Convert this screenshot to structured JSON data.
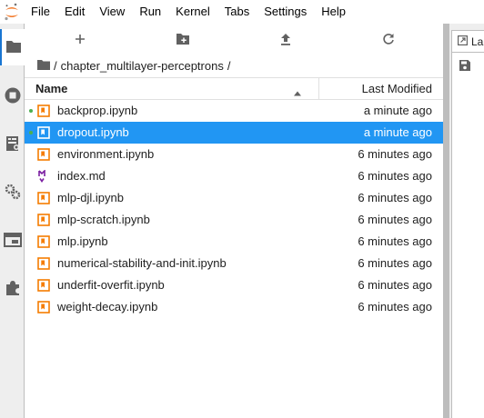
{
  "menubar": {
    "items": [
      "File",
      "Edit",
      "View",
      "Run",
      "Kernel",
      "Tabs",
      "Settings",
      "Help"
    ]
  },
  "activity_bar": {
    "icons": [
      "folder-icon",
      "running-icon",
      "commands-icon",
      "property-inspector-icon",
      "tabs-icon",
      "extension-icon"
    ]
  },
  "file_browser": {
    "toolbar": [
      "new-launcher-icon",
      "new-folder-icon",
      "upload-icon",
      "refresh-icon"
    ],
    "breadcrumb": {
      "separator": "/",
      "folder": "chapter_multilayer-perceptrons"
    },
    "header": {
      "name": "Name",
      "last_modified": "Last Modified"
    },
    "files": [
      {
        "name": "backprop.ipynb",
        "modified": "a minute ago",
        "type": "notebook",
        "running": true,
        "selected": false
      },
      {
        "name": "dropout.ipynb",
        "modified": "a minute ago",
        "type": "notebook",
        "running": true,
        "selected": true
      },
      {
        "name": "environment.ipynb",
        "modified": "6 minutes ago",
        "type": "notebook",
        "running": false,
        "selected": false
      },
      {
        "name": "index.md",
        "modified": "6 minutes ago",
        "type": "markdown",
        "running": false,
        "selected": false
      },
      {
        "name": "mlp-djl.ipynb",
        "modified": "6 minutes ago",
        "type": "notebook",
        "running": false,
        "selected": false
      },
      {
        "name": "mlp-scratch.ipynb",
        "modified": "6 minutes ago",
        "type": "notebook",
        "running": false,
        "selected": false
      },
      {
        "name": "mlp.ipynb",
        "modified": "6 minutes ago",
        "type": "notebook",
        "running": false,
        "selected": false
      },
      {
        "name": "numerical-stability-and-init.ipynb",
        "modified": "6 minutes ago",
        "type": "notebook",
        "running": false,
        "selected": false
      },
      {
        "name": "underfit-overfit.ipynb",
        "modified": "6 minutes ago",
        "type": "notebook",
        "running": false,
        "selected": false
      },
      {
        "name": "weight-decay.ipynb",
        "modified": "6 minutes ago",
        "type": "notebook",
        "running": false,
        "selected": false
      }
    ]
  },
  "dock": {
    "tab_label": "La"
  },
  "colors": {
    "accent": "#2196f3",
    "notebook_icon": "#f57c00",
    "markdown_icon": "#7b1fa2",
    "running_dot": "#4caf50"
  }
}
